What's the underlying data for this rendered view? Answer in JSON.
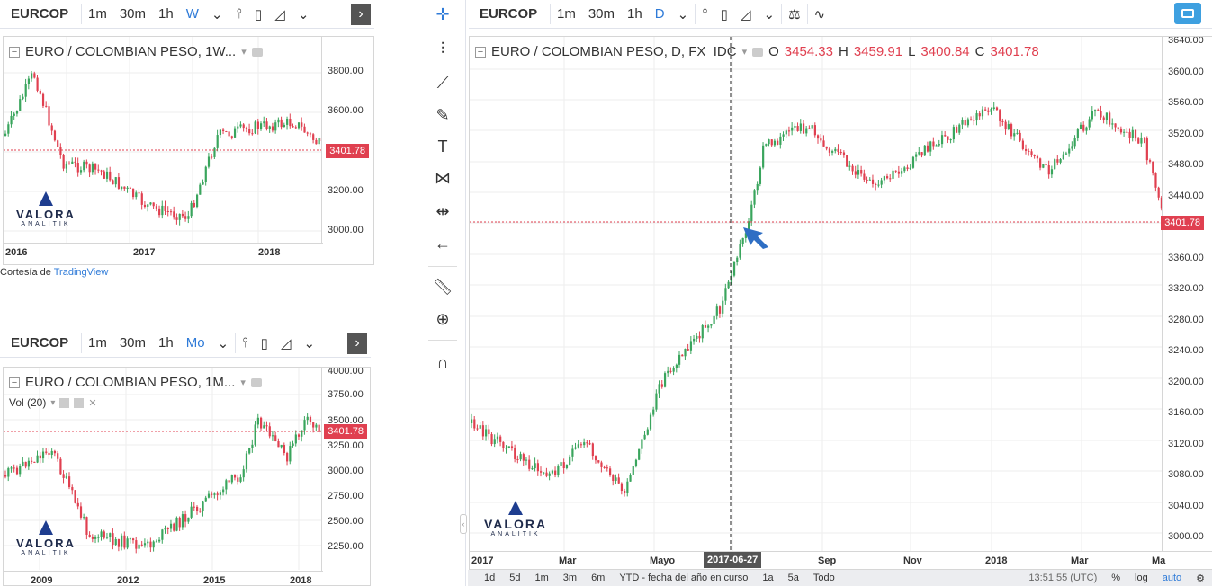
{
  "panel_a": {
    "symbol": "EURCOP",
    "timeframes": [
      "1m",
      "30m",
      "1h",
      "W"
    ],
    "active_tf": "W",
    "legend": "EURO / COLOMBIAN PESO, 1W...",
    "price_ticks": [
      "3800.00",
      "3600.00",
      "3200.00",
      "3000.00"
    ],
    "last_price": "3401.78",
    "time_labels": [
      "2016",
      "2017",
      "2018"
    ],
    "logo": "VALORA",
    "logo_sub": "ANALITIK"
  },
  "courtesy": {
    "prefix": "Cortesía de ",
    "link": "TradingView"
  },
  "panel_b": {
    "symbol": "EURCOP",
    "timeframes": [
      "1m",
      "30m",
      "1h",
      "Mo"
    ],
    "active_tf": "Mo",
    "legend": "EURO / COLOMBIAN PESO, 1M...",
    "vol_label": "Vol (20)",
    "price_ticks": [
      "4000.00",
      "3750.00",
      "3500.00",
      "3250.00",
      "3000.00",
      "2750.00",
      "2500.00",
      "2250.00"
    ],
    "last_price": "3401.78",
    "time_labels": [
      "2009",
      "2012",
      "2015",
      "2018"
    ],
    "logo": "VALORA",
    "logo_sub": "ANALITIK"
  },
  "main": {
    "symbol": "EURCOP",
    "timeframes": [
      "1m",
      "30m",
      "1h",
      "D"
    ],
    "active_tf": "D",
    "legend": "EURO / COLOMBIAN PESO, D, FX_IDC",
    "ohlc": {
      "o": "3454.33",
      "h": "3459.91",
      "l": "3400.84",
      "c": "3401.78"
    },
    "price_ticks": [
      "3640.00",
      "3600.00",
      "3560.00",
      "3520.00",
      "3480.00",
      "3440.00",
      "3360.00",
      "3320.00",
      "3280.00",
      "3240.00",
      "3200.00",
      "3160.00",
      "3120.00",
      "3080.00",
      "3040.00",
      "3000.00"
    ],
    "last_price": "3401.78",
    "time_labels": [
      "2017",
      "Mar",
      "Mayo",
      "Sep",
      "Nov",
      "2018",
      "Mar",
      "Ma"
    ],
    "crosshair_date": "2017-06-27",
    "logo": "VALORA",
    "logo_sub": "ANALITIK",
    "bottom_ranges": [
      "1d",
      "5d",
      "1m",
      "3m",
      "6m",
      "YTD - fecha del año en curso",
      "1a",
      "5a",
      "Todo"
    ],
    "clock": "13:51:55 (UTC)",
    "right_opts": [
      "%",
      "log",
      "auto"
    ]
  },
  "colors": {
    "up": "#3aa55d",
    "down": "#e04050",
    "accent": "#2f7bd8",
    "arrow": "#2f6fc4"
  },
  "tools": [
    "crosshair-icon",
    "vertical-line-icon",
    "fib-icon",
    "brush-icon",
    "text-icon",
    "pattern-icon",
    "measure-icon",
    "back-arrow-icon",
    "ruler-icon",
    "zoom-icon",
    "magnet-icon"
  ]
}
